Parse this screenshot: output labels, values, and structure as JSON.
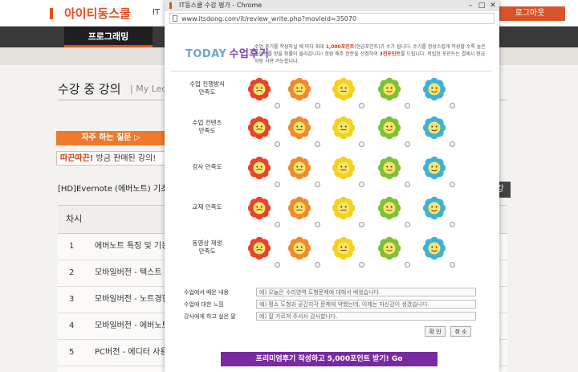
{
  "background": {
    "logo": "아이티동스쿨",
    "it_link": "IT",
    "logout": "로그아웃",
    "nav_item": "프로그래밍",
    "page_title": "수강 중 강의",
    "page_title_sub": "| My Lectu",
    "faq_button": "자주 하는 질문 ▷",
    "event_highlight": "따끈따끈!",
    "event_text": " 방금 판매된 강의!",
    "course_title": "[HD]Evernote (에버노트) 기초에서",
    "right_button": "강",
    "table_header_no": "차시",
    "table_header_right": "기",
    "rows": [
      {
        "no": "1",
        "title": "에버노트 특징 및 기능"
      },
      {
        "no": "2",
        "title": "모바일버전 - 텍스트 노"
      },
      {
        "no": "3",
        "title": "모바일버전 - 노트경험"
      },
      {
        "no": "4",
        "title": "모바일버전 - 에버노트"
      },
      {
        "no": "5",
        "title": "PC버전 - 에디터 사용"
      }
    ]
  },
  "popup": {
    "window_title": "IT동스쿨 수강 평가 - Chrome",
    "url": "www.itsdong.com/it/review_write.php?movieid=35070",
    "today_label": "TODAY",
    "review_label": "수업후기",
    "intro_1": "수업 후기를 작성하실 때 마다 최대 ",
    "intro_points": "1,000포인트",
    "intro_2": "(현금포인트)가 수가 됩니다. 수기를 정성스럽게 작성할 수록 높은 포인트를 받을 확률이 올라갑니다! 정원 매주 한분을 선정하여 ",
    "intro_points2": "3천포인트",
    "intro_3": "를 드립니다. 적립된 포인트는 결제시 현금처럼 사용 가능합니다.",
    "questions": [
      {
        "label": "수업 진행방식\n만족도"
      },
      {
        "label": "수업 컨텐츠\n만족도"
      },
      {
        "label": "강사 만족도"
      },
      {
        "label": "교재 만족도"
      },
      {
        "label": "동영상 재생\n만족도"
      }
    ],
    "colors": {
      "face_red": "#e8432c",
      "face_orange": "#f08a2a",
      "face_yellow": "#f2d21c",
      "face_green": "#7cc234",
      "face_blue": "#3fb1d6",
      "premium": "#7a2aa1"
    },
    "comments": [
      {
        "label": "수업에서 배운 내용",
        "value": "예) 오늘은 수리영역 도형문제에 대해서 배웠습니다."
      },
      {
        "label": "수업에 대한 느낌",
        "value": "예) 평소 도형과 공간지각 문제에 약했는데, 이제는 자신감이 생겼습니다."
      },
      {
        "label": "강사에게 하고 싶은 말",
        "value": "예) 잘 가르쳐 주셔서 감사합니다."
      }
    ],
    "confirm": "확 인",
    "cancel": "취 소",
    "premium_button": "프리미엄후기 작성하고 5,000포인트 받기! Go"
  }
}
